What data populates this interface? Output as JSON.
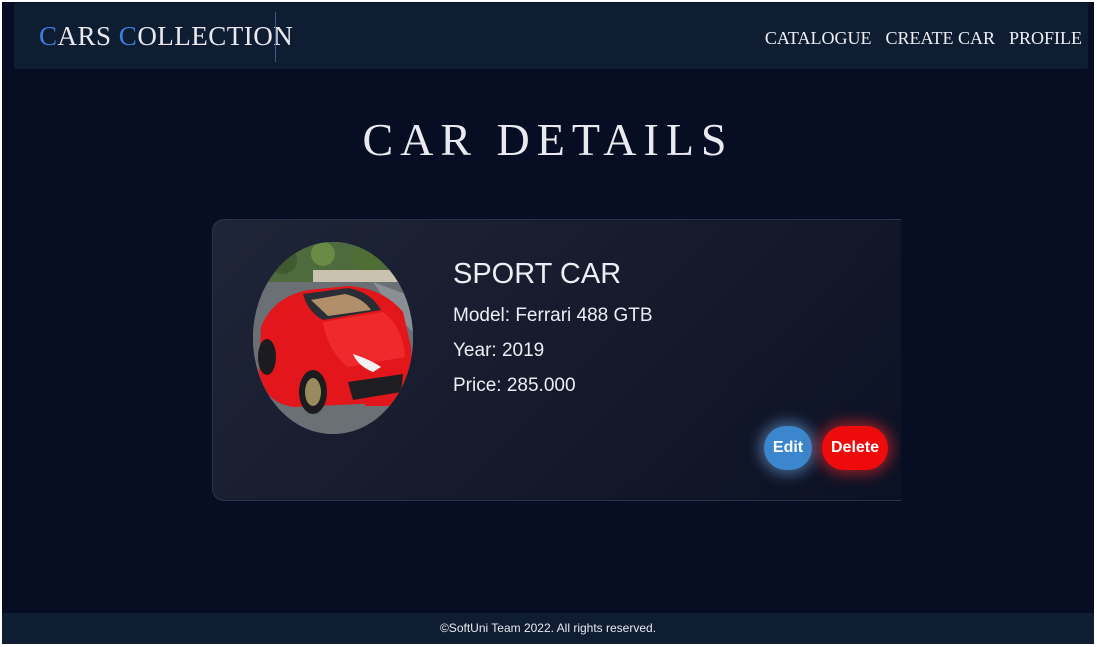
{
  "header": {
    "logo_part1_cap": "C",
    "logo_part1_rest": "ARS ",
    "logo_part2_cap": "C",
    "logo_part2_rest": "OLLECTION",
    "nav": [
      {
        "label": "CATALOGUE"
      },
      {
        "label": "CREATE CAR"
      },
      {
        "label": "PROFILE"
      }
    ]
  },
  "main": {
    "title": "CAR DETAILS",
    "car": {
      "type": "SPORT CAR",
      "model_label": "Model: ",
      "model": "Ferrari 488 GTB",
      "year_label": "Year: ",
      "year": "2019",
      "price_label": "Price: ",
      "price": "285.000",
      "image_icon": "red-sports-car-photo"
    },
    "actions": {
      "edit_label": "Edit",
      "delete_label": "Delete"
    }
  },
  "footer": {
    "text": "©SoftUni Team 2022. All rights reserved."
  },
  "colors": {
    "background": "#070d22",
    "header_bg": "#0f1d33",
    "logo_accent": "#3b7fd8",
    "edit_button": "#3b86cc",
    "delete_button": "#ee0b0b"
  }
}
